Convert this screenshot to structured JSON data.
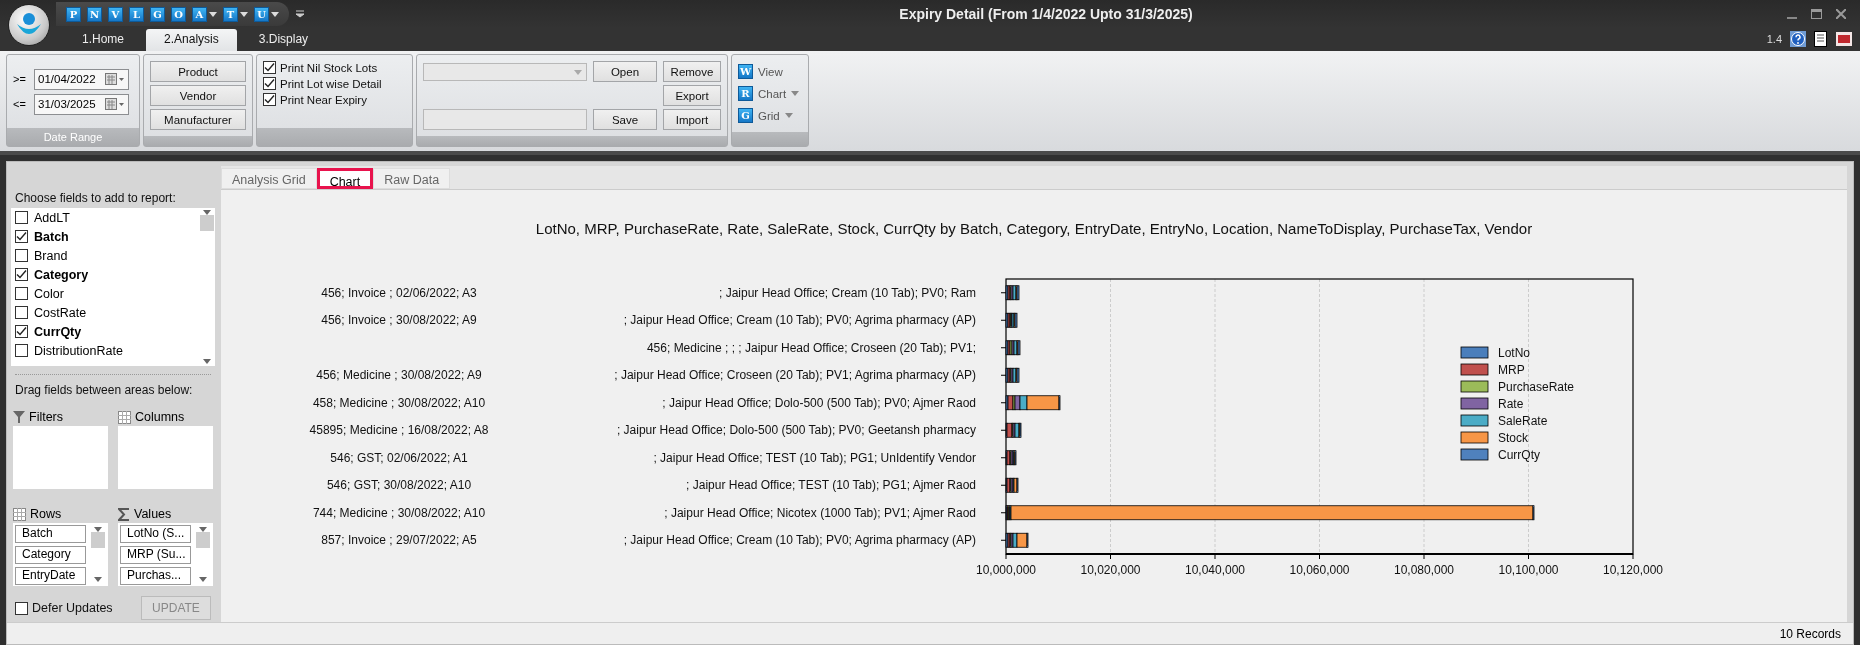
{
  "window": {
    "title": "Expiry Detail (From 1/4/2022 Upto 31/3/2025)",
    "version": "1.4"
  },
  "quick_access": [
    {
      "letter": "P",
      "dropdown": false
    },
    {
      "letter": "N",
      "dropdown": false
    },
    {
      "letter": "V",
      "dropdown": false
    },
    {
      "letter": "L",
      "dropdown": false
    },
    {
      "letter": "G",
      "dropdown": false
    },
    {
      "letter": "O",
      "dropdown": false
    },
    {
      "letter": "A",
      "dropdown": true
    },
    {
      "letter": "T",
      "dropdown": true
    },
    {
      "letter": "U",
      "dropdown": true
    }
  ],
  "ribbon_tabs": [
    {
      "label": "1.Home",
      "selected": false
    },
    {
      "label": "2.Analysis",
      "selected": true
    },
    {
      "label": "3.Display",
      "selected": false
    }
  ],
  "date_range": {
    "caption": "Date Range",
    "from_op": ">=",
    "from": "01/04/2022",
    "to_op": "<=",
    "to": "31/03/2025"
  },
  "filter_buttons": [
    "Product",
    "Vendor",
    "Manufacturer"
  ],
  "options": [
    {
      "label": "Print Nil Stock Lots",
      "checked": true
    },
    {
      "label": "Print Lot wise Detail",
      "checked": true
    },
    {
      "label": "Print Near Expiry",
      "checked": true
    }
  ],
  "layout_buttons": {
    "open": "Open",
    "remove": "Remove",
    "export": "Export",
    "save": "Save",
    "import": "Import"
  },
  "view_menu": [
    {
      "letter": "W",
      "label": "View",
      "dropdown": false
    },
    {
      "letter": "R",
      "label": "Chart",
      "dropdown": true
    },
    {
      "letter": "G",
      "label": "Grid",
      "dropdown": true
    }
  ],
  "field_list": {
    "heading": "Choose fields to add to report:",
    "fields": [
      {
        "name": "AddLT",
        "checked": false
      },
      {
        "name": "Batch",
        "checked": true
      },
      {
        "name": "Brand",
        "checked": false
      },
      {
        "name": "Category",
        "checked": true
      },
      {
        "name": "Color",
        "checked": false
      },
      {
        "name": "CostRate",
        "checked": false
      },
      {
        "name": "CurrQty",
        "checked": true
      },
      {
        "name": "DistributionRate",
        "checked": false
      }
    ]
  },
  "areas": {
    "heading": "Drag fields between areas below:",
    "filters": "Filters",
    "columns": "Columns",
    "rows": "Rows",
    "values": "Values",
    "row_items": [
      "Batch",
      "Category",
      "EntryDate"
    ],
    "value_items": [
      "LotNo (S...",
      "MRP (Su...",
      "Purchas..."
    ]
  },
  "defer_updates": {
    "label": "Defer Updates",
    "checked": false
  },
  "update_button": "UPDATE",
  "view_tabs": [
    {
      "label": "Analysis Grid",
      "selected": false
    },
    {
      "label": "Chart",
      "selected": true
    },
    {
      "label": "Raw Data",
      "selected": false
    }
  ],
  "chart": {
    "row_groups": [
      {
        "kind": "group",
        "text": "456; Invoice ; 02/06/2022; A3"
      },
      {
        "kind": "group",
        "text": "456; Invoice ; 30/08/2022; A9"
      },
      {
        "kind": "none"
      },
      {
        "kind": "group",
        "text": "456; Medicine ; 30/08/2022; A9"
      },
      {
        "kind": "group",
        "text": "458; Medicine ; 30/08/2022; A10"
      },
      {
        "kind": "group",
        "text": "45895; Medicine ; 16/08/2022; A8"
      },
      {
        "kind": "group",
        "text": "546; GST; 02/06/2022; A1"
      },
      {
        "kind": "group",
        "text": "546; GST; 30/08/2022; A10"
      },
      {
        "kind": "group",
        "text": "744; Medicine ; 30/08/2022; A10"
      },
      {
        "kind": "group",
        "text": "857; Invoice ; 29/07/2022; A5"
      }
    ],
    "title": "LotNo, MRP, PurchaseRate, Rate, SaleRate, Stock, CurrQty by Batch, Category, EntryDate, EntryNo, Location, NameToDisplay, PurchaseTax, Vendor",
    "categories": [
      "; Jaipur Head Office; Cream (10 Tab); PV0; Ram",
      "; Jaipur Head Office; Cream (10 Tab); PV0; Agrima pharmacy (AP)",
      "456; Medicine ; ; ; Jaipur Head Office; Croseen (20 Tab); PV1;",
      "; Jaipur Head Office; Croseen (20 Tab); PV1; Agrima pharmacy (AP)",
      "; Jaipur Head Office; Dolo-500 (500 Tab); PV0; Ajmer Raod",
      "; Jaipur Head Office; Dolo-500 (500 Tab); PV0; Geetansh pharmacy",
      "; Jaipur Head Office; TEST (10 Tab); PG1; UnIdentify Vendor",
      "; Jaipur Head Office; TEST (10 Tab); PG1; Ajmer Raod",
      "; Jaipur Head Office; Nicotex (1000 Tab); PV1; Ajmer Raod",
      "; Jaipur Head Office; Cream (10 Tab); PV0; Agrima pharmacy (AP)"
    ],
    "legend": [
      {
        "name": "LotNo",
        "color": "#4a7ebb"
      },
      {
        "name": "MRP",
        "color": "#c0504d"
      },
      {
        "name": "PurchaseRate",
        "color": "#9bbb59"
      },
      {
        "name": "Rate",
        "color": "#8064a2"
      },
      {
        "name": "SaleRate",
        "color": "#4bacc6"
      },
      {
        "name": "Stock",
        "color": "#f79646"
      },
      {
        "name": "CurrQty",
        "color": "#4f81bd"
      }
    ],
    "axis_labels": [
      "10,000,000",
      "10,020,000",
      "10,040,000",
      "10,060,000",
      "10,080,000",
      "10,100,000",
      "10,120,000"
    ]
  },
  "status_bar": {
    "records": "10 Records"
  }
}
